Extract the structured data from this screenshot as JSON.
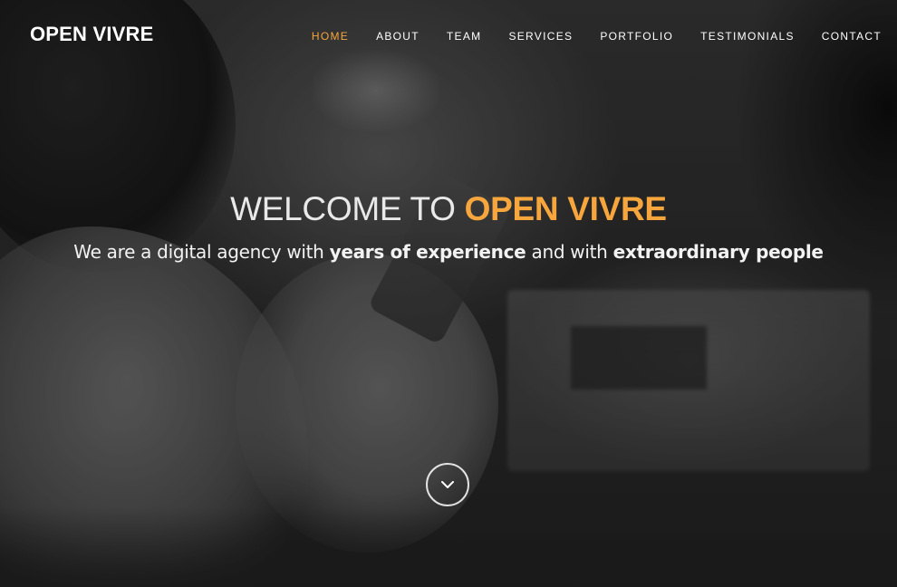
{
  "brand": "OPEN VIVRE",
  "nav": {
    "items": [
      {
        "label": "HOME",
        "active": true
      },
      {
        "label": "ABOUT",
        "active": false
      },
      {
        "label": "TEAM",
        "active": false
      },
      {
        "label": "SERVICES",
        "active": false
      },
      {
        "label": "PORTFOLIO",
        "active": false
      },
      {
        "label": "TESTIMONIALS",
        "active": false
      },
      {
        "label": "CONTACT",
        "active": false
      }
    ]
  },
  "hero": {
    "headline_prefix": "WELCOME TO ",
    "headline_accent": "OPEN VIVRE",
    "sub_part1": "We are a digital agency with ",
    "sub_bold1": "years of experience",
    "sub_part2": " and with ",
    "sub_bold2": "extraordinary people",
    "scroll_icon": "chevron-down-icon"
  },
  "colors": {
    "accent": "#f6a63c",
    "text": "#ffffff"
  }
}
